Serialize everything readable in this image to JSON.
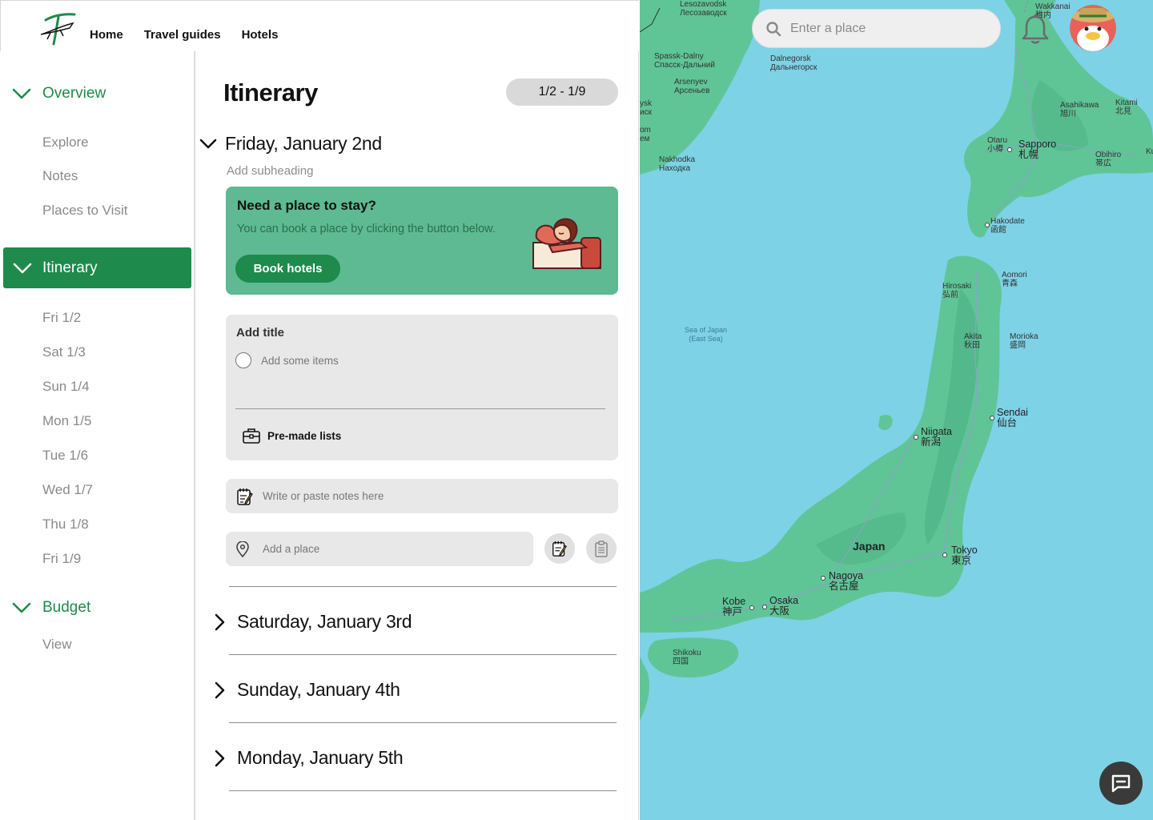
{
  "nav": {
    "home": "Home",
    "guides": "Travel guides",
    "hotels": "Hotels"
  },
  "sidebar": {
    "overview": {
      "label": "Overview",
      "items": [
        "Explore",
        "Notes",
        "Places to Visit"
      ]
    },
    "itinerary": {
      "label": "Itinerary",
      "items": [
        "Fri 1/2",
        "Sat 1/3",
        "Sun 1/4",
        "Mon 1/5",
        "Tue 1/6",
        "Wed 1/7",
        "Thu 1/8",
        "Fri 1/9"
      ]
    },
    "budget": {
      "label": "Budget",
      "items": [
        "View"
      ]
    }
  },
  "main": {
    "title": "Itinerary",
    "date_range": "1/2 - 1/9",
    "day1": {
      "heading": "Friday, January 2nd",
      "subheading_placeholder": "Add subheading",
      "hotel_card": {
        "title": "Need a place to stay?",
        "text": "You can book a place by clicking the button below.",
        "button": "Book hotels"
      },
      "list_card": {
        "title_placeholder": "Add title",
        "item_placeholder": "Add some items",
        "premade": "Pre-made lists"
      },
      "notes_placeholder": "Write or paste notes here",
      "place_placeholder": "Add a place"
    },
    "days": [
      "Saturday, January 3rd",
      "Sunday, January 4th",
      "Monday, January 5th"
    ]
  },
  "map": {
    "search_placeholder": "Enter a place",
    "labels": {
      "lesozavodsk": "Lesozavodsk\nЛесозаводск",
      "wakkanai": "Wakkanai\n稚内",
      "spassk": "Spassk-Dalny\nСпасск-Дальний",
      "dalnegorsk": "Dalnegorsk\nДальнегорск",
      "arsenyev": "Arsenyev\nАрсеньев",
      "usk": "ysk\nиск",
      "om": "om\nем",
      "nakhodka": "Nakhodka\nНаходка",
      "asahikawa": "Asahikawa\n旭川",
      "kitami": "Kitami\n北見",
      "otaru": "Otaru\n小樽",
      "sapporo": "Sapporo\n札幌",
      "obihiro": "Obihiro\n帯広",
      "ku": "Ku",
      "hakodate": "Hakodate\n函館",
      "aomori": "Aomori\n青森",
      "hirosaki": "Hirosaki\n弘前",
      "sea": "Sea of Japan\n(East Sea)",
      "akita": "Akita\n秋田",
      "morioka": "Morioka\n盛岡",
      "sendai": "Sendai\n仙台",
      "niigata": "Niigata\n新潟",
      "japan": "Japan",
      "tokyo": "Tokyo\n東京",
      "nagoya": "Nagoya\n名古屋",
      "kobe": "Kobe\n神戸",
      "osaka": "Osaka\n大阪",
      "shikoku": "Shikoku\n四国"
    }
  },
  "colors": {
    "brand_green": "#1e8a4c",
    "card_green": "#5dba92",
    "sea": "#7dd2e6",
    "land": "#5fc597"
  },
  "icons": {
    "logo": "travel-logo-icon",
    "search": "search-icon",
    "bell": "bell-icon",
    "chat": "chat-icon"
  }
}
